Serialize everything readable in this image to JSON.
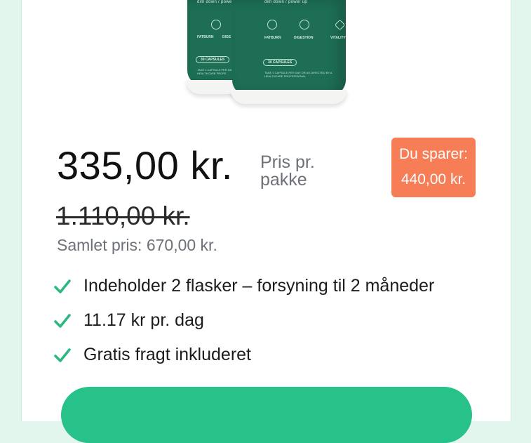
{
  "product_image": {
    "bottle_front": {
      "tagline": "dim down / power up",
      "benefits": [
        "FATBURN",
        "DIGESTION",
        "VITALITY"
      ],
      "capsules": "30 CAPSULES",
      "directions": "TAKE 1 CAPSULE PER DAY OR AS DIRECTED BY A HEALTHCARE PROFESSIONAL"
    },
    "bottle_back": {
      "tagline": "dim down / powe",
      "benefits": [
        "FATBURN",
        "DIGE"
      ],
      "capsules": "30 CAPSULES",
      "directions": "TAKE 1 CAPSULE PER DA A HEALTHCARE PROFE"
    }
  },
  "pricing": {
    "price": "335,00 kr.",
    "unit": "Pris pr. pakke",
    "original_price": "1.110,00 kr.",
    "total": "Samlet pris: 670,00 kr.",
    "savings_label": "Du sparer:",
    "savings_amount": "440,00 kr."
  },
  "features": [
    "Indeholder 2 flasker – forsyning til 2 måneder",
    "11.17 kr pr. dag",
    "Gratis fragt inkluderet"
  ],
  "colors": {
    "accent": "#27c18a",
    "check": "#2bb97f",
    "savings_bg": "#f77d57",
    "bottle": "#1d6e55",
    "page_bg": "#e3f6ee"
  },
  "icons": [
    "check-icon",
    "fatburn-icon",
    "digestion-icon",
    "vitality-icon"
  ]
}
